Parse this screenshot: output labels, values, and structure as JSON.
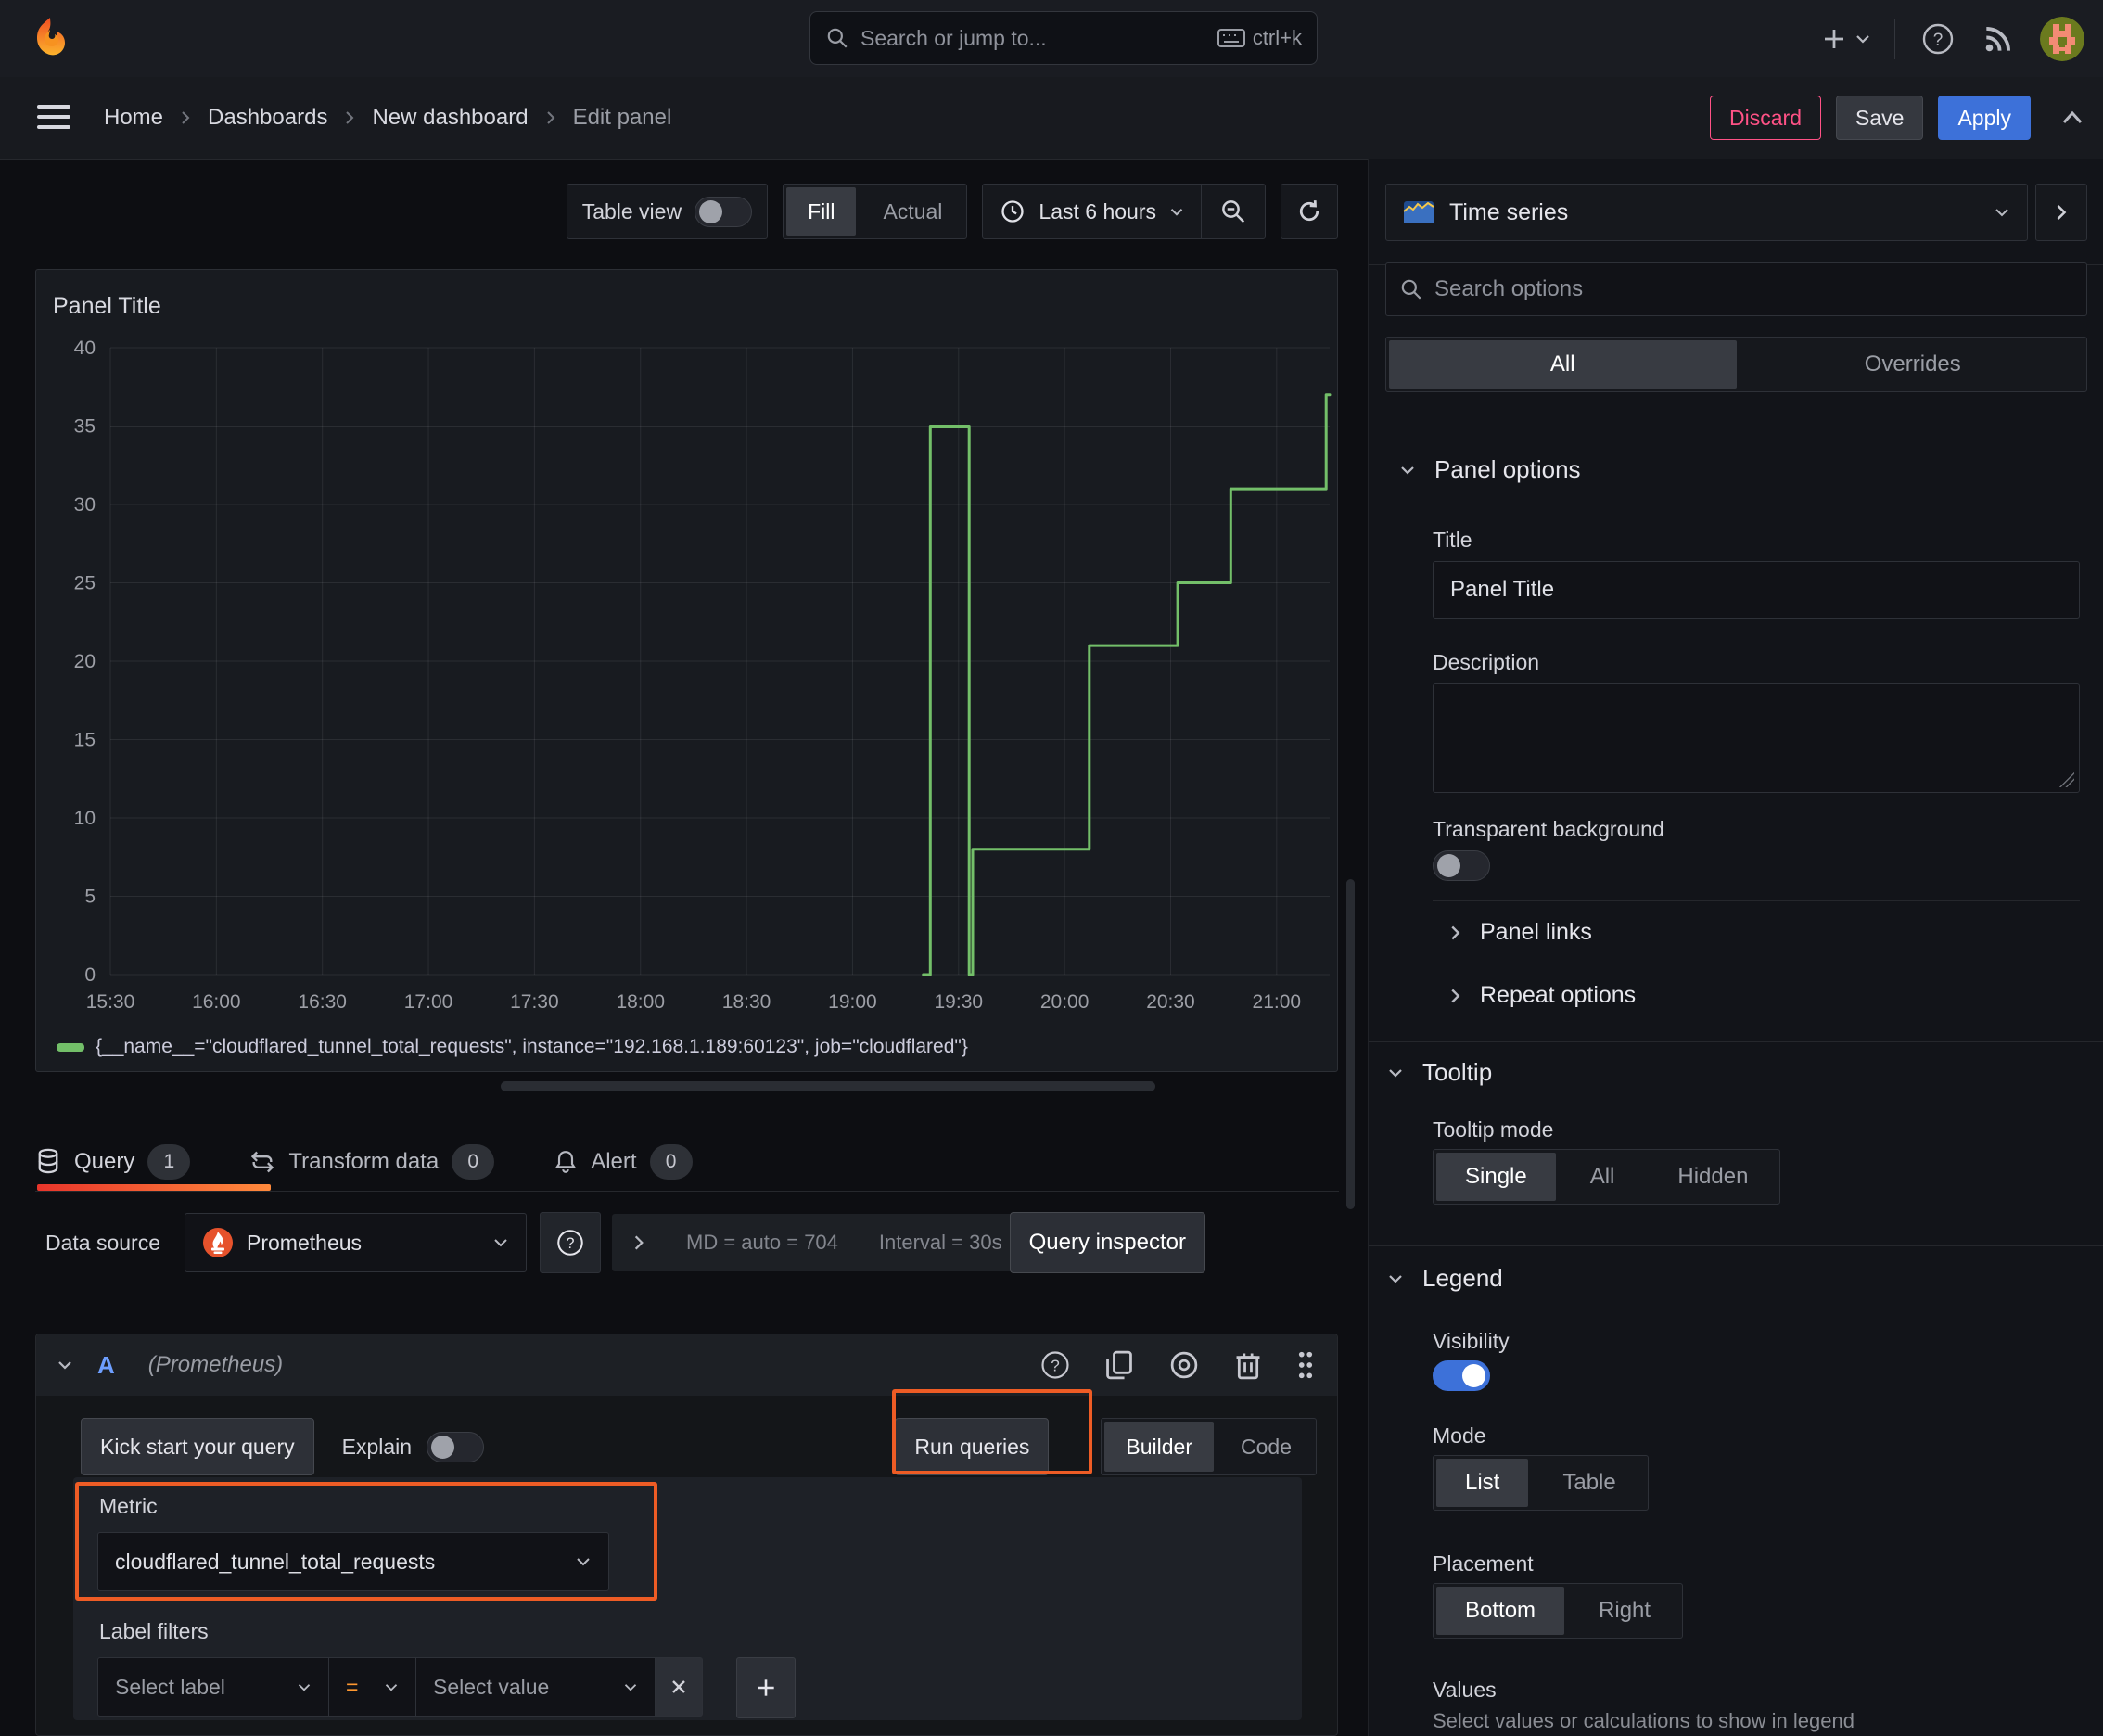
{
  "topbar": {
    "search_placeholder": "Search or jump to...",
    "shortcut": "ctrl+k"
  },
  "breadcrumb": {
    "items": [
      "Home",
      "Dashboards",
      "New dashboard",
      "Edit panel"
    ]
  },
  "actions": {
    "discard": "Discard",
    "save": "Save",
    "apply": "Apply"
  },
  "panel_toolbar": {
    "table_view": "Table view",
    "fill": "Fill",
    "actual": "Actual",
    "time_range": "Last 6 hours"
  },
  "panel": {
    "title": "Panel Title"
  },
  "chart_data": {
    "type": "line",
    "title": "Panel Title",
    "xlabel": "",
    "ylabel": "",
    "ylim": [
      0,
      40
    ],
    "y_ticks": [
      0,
      5,
      10,
      15,
      20,
      25,
      30,
      35,
      40
    ],
    "x_ticks": [
      "15:30",
      "16:00",
      "16:30",
      "17:00",
      "17:30",
      "18:00",
      "18:30",
      "19:00",
      "19:30",
      "20:00",
      "20:30",
      "21:00"
    ],
    "x_range": [
      "15:30",
      "21:15"
    ],
    "grid": true,
    "legend_position": "bottom",
    "series": [
      {
        "name": "{__name__=\"cloudflared_tunnel_total_requests\", instance=\"192.168.1.189:60123\", job=\"cloudflared\"}",
        "color": "#73bf69",
        "points": [
          [
            "19:20",
            0
          ],
          [
            "19:22",
            0
          ],
          [
            "19:22",
            35
          ],
          [
            "19:33",
            35
          ],
          [
            "19:33",
            0
          ],
          [
            "19:34",
            0
          ],
          [
            "19:34",
            8
          ],
          [
            "20:07",
            8
          ],
          [
            "20:07",
            21
          ],
          [
            "20:32",
            21
          ],
          [
            "20:32",
            25
          ],
          [
            "20:47",
            25
          ],
          [
            "20:47",
            31
          ],
          [
            "21:14",
            31
          ],
          [
            "21:14",
            37
          ],
          [
            "21:15",
            37
          ]
        ]
      }
    ]
  },
  "tabs": {
    "query": "Query",
    "query_count": "1",
    "transform": "Transform data",
    "transform_count": "0",
    "alert": "Alert",
    "alert_count": "0"
  },
  "datasource": {
    "label": "Data source",
    "name": "Prometheus",
    "stats_md": "MD = auto = 704",
    "stats_interval": "Interval = 30s",
    "query_inspector": "Query inspector"
  },
  "query_editor": {
    "ref_id": "A",
    "ds_hint": "(Prometheus)",
    "kick_start": "Kick start your query",
    "explain": "Explain",
    "run_queries": "Run queries",
    "builder": "Builder",
    "code": "Code",
    "metric_label": "Metric",
    "metric_value": "cloudflared_tunnel_total_requests",
    "label_filters": "Label filters",
    "select_label": "Select label",
    "equals": "=",
    "select_value": "Select value"
  },
  "sidebar": {
    "visualization": "Time series",
    "search_placeholder": "Search options",
    "tabs": {
      "all": "All",
      "overrides": "Overrides"
    },
    "panel_options": {
      "title": "Panel options",
      "title_label": "Title",
      "title_value": "Panel Title",
      "description_label": "Description",
      "transparent_label": "Transparent background"
    },
    "panel_links": "Panel links",
    "repeat_options": "Repeat options",
    "tooltip": {
      "title": "Tooltip",
      "mode_label": "Tooltip mode",
      "options": [
        "Single",
        "All",
        "Hidden"
      ]
    },
    "legend": {
      "title": "Legend",
      "visibility_label": "Visibility",
      "mode_label": "Mode",
      "mode_options": [
        "List",
        "Table"
      ],
      "placement_label": "Placement",
      "placement_options": [
        "Bottom",
        "Right"
      ],
      "values_label": "Values",
      "values_hint": "Select values or calculations to show in legend"
    }
  },
  "colors": {
    "series_green": "#73bf69",
    "apply_blue": "#3d71d9",
    "discard_pink": "#ff5286",
    "annotation_orange": "#ee5c25",
    "tab_active_gradient_start": "#e8352b",
    "tab_active_gradient_end": "#ff8a3c"
  }
}
